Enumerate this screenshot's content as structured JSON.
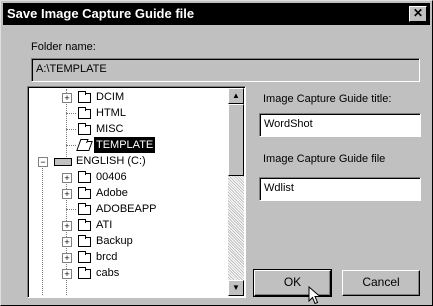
{
  "dialog": {
    "title": "Save Image Capture Guide file",
    "close_glyph": "✕"
  },
  "folder": {
    "label": "Folder name:",
    "value": "A:\\TEMPLATE"
  },
  "tree": {
    "items": [
      {
        "label": "DCIM",
        "icon": "folder-icon"
      },
      {
        "label": "HTML",
        "icon": "folder-icon"
      },
      {
        "label": "MISC",
        "icon": "folder-icon"
      },
      {
        "label": "TEMPLATE",
        "icon": "open-folder-icon",
        "selected": true
      },
      {
        "label": "ENGLISH (C:)",
        "icon": "drive-icon"
      },
      {
        "label": "00406",
        "icon": "folder-icon"
      },
      {
        "label": "Adobe",
        "icon": "folder-icon"
      },
      {
        "label": "ADOBEAPP",
        "icon": "folder-icon"
      },
      {
        "label": "ATI",
        "icon": "folder-icon"
      },
      {
        "label": "Backup",
        "icon": "folder-icon"
      },
      {
        "label": "brcd",
        "icon": "folder-icon"
      },
      {
        "label": "cabs",
        "icon": "folder-icon"
      }
    ]
  },
  "title_field": {
    "label": "Image Capture Guide title:",
    "value": "WordShot"
  },
  "file_field": {
    "label": "Image Capture Guide file",
    "value": "Wdlist"
  },
  "buttons": {
    "ok": "OK",
    "cancel": "Cancel"
  },
  "glyphs": {
    "plus": "+",
    "minus": "−",
    "up": "▲",
    "down": "▼"
  }
}
